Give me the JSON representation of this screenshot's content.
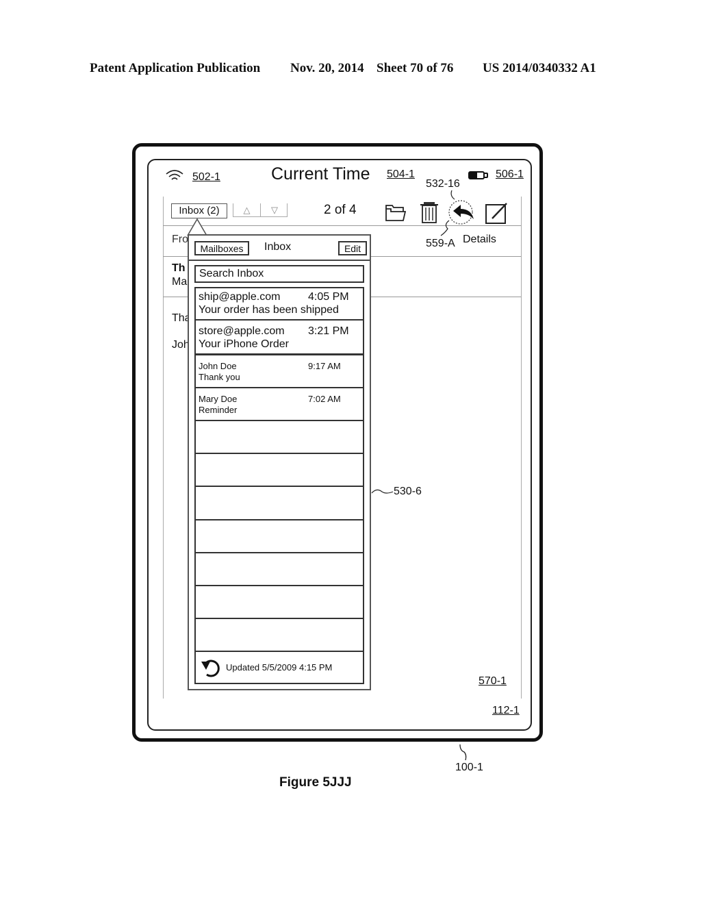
{
  "header": {
    "publication": "Patent Application Publication",
    "date": "Nov. 20, 2014",
    "sheet": "Sheet 70 of 76",
    "patent_number": "US 2014/0340332 A1"
  },
  "status_bar": {
    "wifi_icon": "wifi-icon",
    "wifi_ref": "502-1",
    "time": "Current Time",
    "time_ref": "504-1",
    "battery_icon": "battery-icon",
    "battery_ref": "506-1"
  },
  "toolbar": {
    "inbox_button": "Inbox (2)",
    "up_arrow": "△",
    "down_arrow": "▽",
    "message_position": "2 of 4",
    "icons": [
      "folder-icon",
      "trash-icon",
      "reply-icon",
      "compose-icon"
    ],
    "reply_ref": "532-16",
    "contact_ref": "559-A",
    "details_label": "Details"
  },
  "message_pane": {
    "from_fragment": "Fro",
    "subject_fragment": "Th",
    "sender_fragment": "Ma",
    "body_fragment_1": "Tha",
    "body_fragment_2": "Joh",
    "ref": "570-1"
  },
  "popover": {
    "mailboxes_button": "Mailboxes",
    "title": "Inbox",
    "edit_button": "Edit",
    "search_placeholder": "Search Inbox",
    "emails": [
      {
        "sender": "ship@apple.com",
        "time": "4:05 PM",
        "subject": "Your order has been shipped"
      },
      {
        "sender": "store@apple.com",
        "time": "3:21 PM",
        "subject": "Your iPhone Order"
      },
      {
        "sender": "John Doe",
        "time": "9:17 AM",
        "subject": "Thank you"
      },
      {
        "sender": "Mary Doe",
        "time": "7:02 AM",
        "subject": "Reminder"
      }
    ],
    "empty_rows": 7,
    "refresh_icon": "refresh-icon",
    "updated_text": "Updated 5/5/2009 4:15 PM",
    "ref": "530-6"
  },
  "screen_ref": "112-1",
  "device_ref": "100-1",
  "figure_caption": "Figure 5JJJ"
}
